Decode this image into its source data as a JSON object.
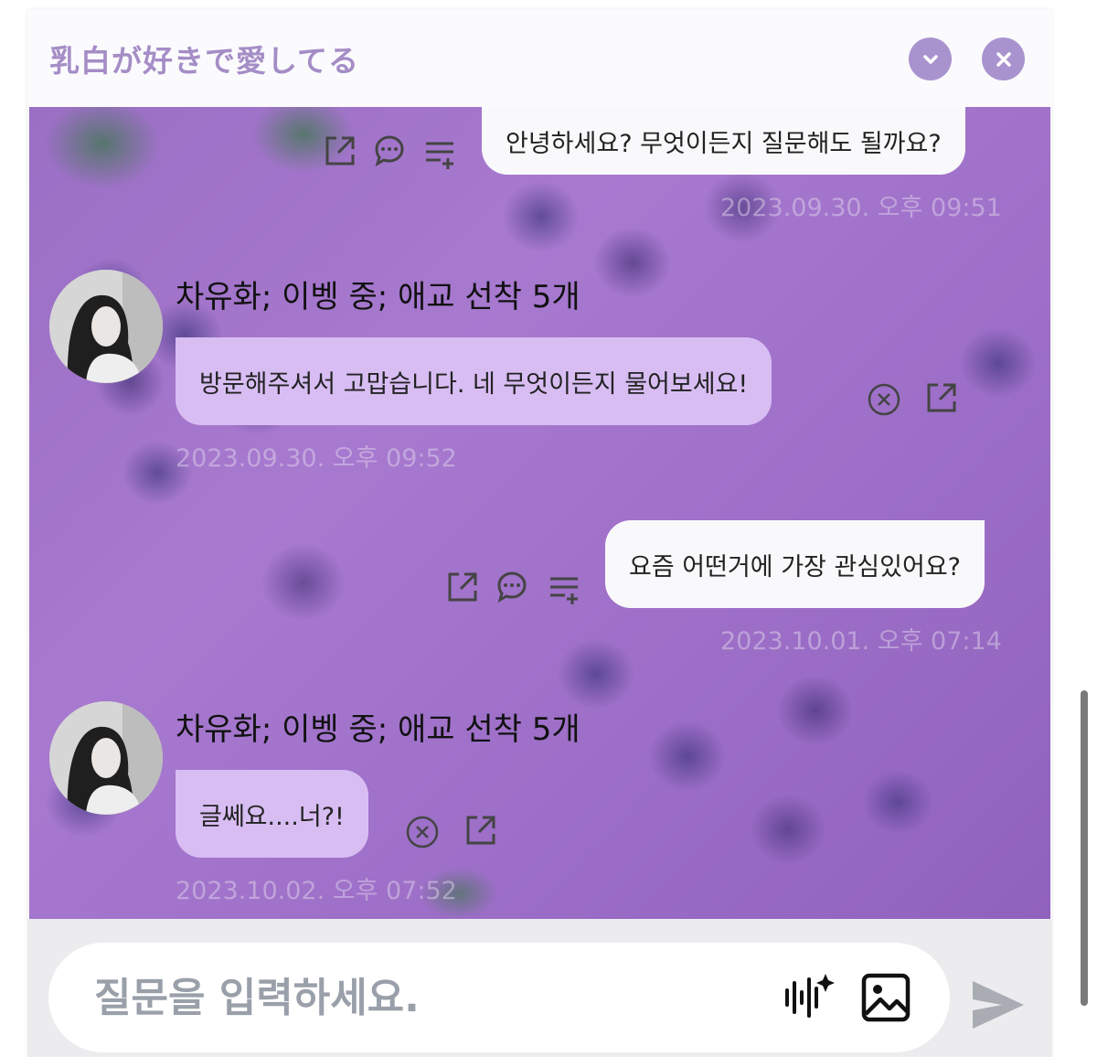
{
  "header": {
    "title": "乳白が好きで愛してる"
  },
  "messages": [
    {
      "sender": "user",
      "text": "안녕하세요? 무엇이든지 질문해도 될까요?",
      "timestamp": "2023.09.30. 오후 09:51"
    },
    {
      "sender": "bot",
      "name": "차유화; 이벵 중; 애교 선착 5개",
      "text": "방문해주셔서 고맙습니다. 네 무엇이든지 물어보세요!",
      "timestamp": "2023.09.30. 오후 09:52"
    },
    {
      "sender": "user",
      "text": "요즘 어떤거에 가장 관심있어요?",
      "timestamp": "2023.10.01. 오후 07:14"
    },
    {
      "sender": "bot",
      "name": "차유화; 이벵 중; 애교 선착 5개",
      "text": "글쎄요....너?!",
      "timestamp": "2023.10.02. 오후 07:52"
    }
  ],
  "composer": {
    "placeholder": "질문을 입력하세요."
  },
  "icons": {
    "collapse": "chevron-down-icon",
    "close": "close-icon",
    "share": "share-icon",
    "comment": "comment-icon",
    "playlist_add": "playlist-add-icon",
    "cancel": "cancel-circle-icon",
    "voice": "voice-sparkle-icon",
    "image": "image-icon",
    "send": "send-icon"
  },
  "colors": {
    "accent": "#a993cf",
    "title": "#a58dc6",
    "bot_bubble": "#d8bdf3",
    "user_bubble": "#f9f9fb"
  }
}
